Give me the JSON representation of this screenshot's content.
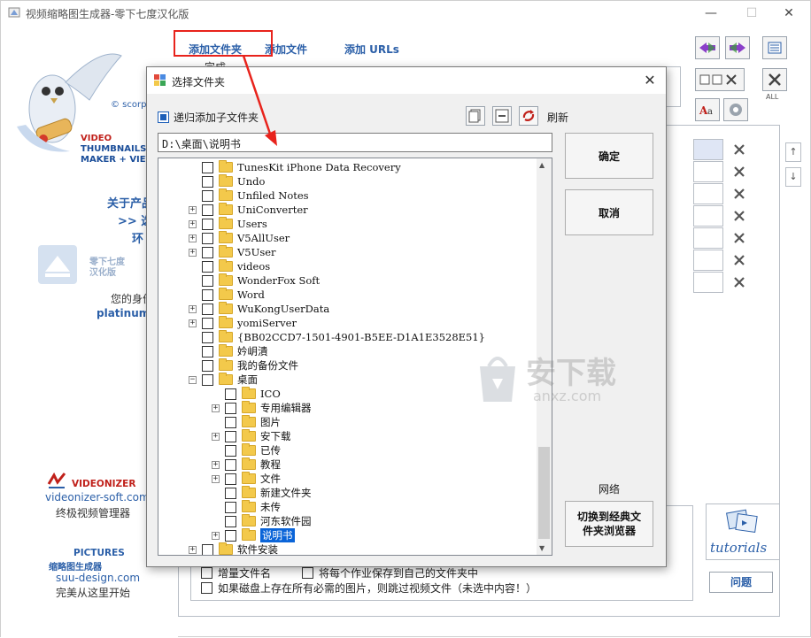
{
  "window": {
    "title": "视频缩略图生成器-零下七度汉化版",
    "minimize": "—",
    "maximize": "☐",
    "close": "✕"
  },
  "top_links": {
    "add_folder": "添加文件夹",
    "add_file": "添加文件",
    "add_urls": "添加 URLs",
    "done_label": "完成"
  },
  "left_panel": {
    "copyright": "© scorp",
    "logo_line1": "VIDEO",
    "logo_line2": "THUMBNAILS",
    "logo_line3": "MAKER + VIEV",
    "about1": "关于产品",
    "about2": ">> 选",
    "about3": "环",
    "hanhua1": "零下七度",
    "hanhua2": "汉化版",
    "identity": "您的身份",
    "edition": "platinum [",
    "videonizer_brand": "VIDEONIZER",
    "videonizer_url": "videonizer-soft.com",
    "videonizer_desc": "终极视频管理器",
    "pictures_brand": "PICTURES",
    "pictures_sub": "缩略图生成器",
    "pictures_url": "suu-design.com",
    "pictures_desc": "完美从这里开始"
  },
  "right_panel": {
    "all_label": "ALL",
    "tutorials_label": "tutorials",
    "problem_button": "问题"
  },
  "bottom_options": {
    "opt1": "增量文件名",
    "opt2": "将每个作业保存到自己的文件夹中",
    "opt3": "如果磁盘上存在所有必需的图片，则跳过视频文件（未选中内容！）"
  },
  "dialog": {
    "title": "选择文件夹",
    "recursive_label": "递归添加子文件夹",
    "refresh_label": "刷新",
    "path_value": "D:\\桌面\\说明书",
    "ok_button": "确定",
    "cancel_button": "取消",
    "network_label": "网络",
    "switch_button": "切换到经典文件夹浏览器",
    "tree": [
      {
        "label": "TunesKit iPhone Data Recovery",
        "expandable": false,
        "level": 0
      },
      {
        "label": "Undo",
        "expandable": false,
        "level": 0
      },
      {
        "label": "Unfiled Notes",
        "expandable": false,
        "level": 0
      },
      {
        "label": "UniConverter",
        "expandable": true,
        "level": 0
      },
      {
        "label": "Users",
        "expandable": true,
        "level": 0
      },
      {
        "label": "V5AllUser",
        "expandable": true,
        "level": 0
      },
      {
        "label": "V5User",
        "expandable": true,
        "level": 0
      },
      {
        "label": "videos",
        "expandable": false,
        "level": 0
      },
      {
        "label": "WonderFox Soft",
        "expandable": false,
        "level": 0
      },
      {
        "label": "Word",
        "expandable": false,
        "level": 0
      },
      {
        "label": "WuKongUserData",
        "expandable": true,
        "level": 0
      },
      {
        "label": "yomiServer",
        "expandable": true,
        "level": 0
      },
      {
        "label": "{BB02CCD7-1501-4901-B5EE-D1A1E3528E51}",
        "expandable": false,
        "level": 0
      },
      {
        "label": "妗岄潰",
        "expandable": false,
        "level": 0
      },
      {
        "label": "我的备份文件",
        "expandable": false,
        "level": 0
      },
      {
        "label": "桌面",
        "expandable": "open",
        "level": 0
      },
      {
        "label": "ICO",
        "expandable": false,
        "level": 1
      },
      {
        "label": "专用编辑器",
        "expandable": true,
        "level": 1
      },
      {
        "label": "图片",
        "expandable": false,
        "level": 1
      },
      {
        "label": "安下载",
        "expandable": true,
        "level": 1
      },
      {
        "label": "已传",
        "expandable": false,
        "level": 1
      },
      {
        "label": "教程",
        "expandable": true,
        "level": 1
      },
      {
        "label": "文件",
        "expandable": true,
        "level": 1
      },
      {
        "label": "新建文件夹",
        "expandable": false,
        "level": 1
      },
      {
        "label": "未传",
        "expandable": false,
        "level": 1
      },
      {
        "label": "河东软件园",
        "expandable": false,
        "level": 1
      },
      {
        "label": "说明书",
        "expandable": true,
        "level": 1,
        "selected": true
      },
      {
        "label": "软件安装",
        "expandable": true,
        "level": 0
      }
    ]
  },
  "watermark": {
    "text": "安下载",
    "url": "anxz.com"
  },
  "colors": {
    "accent": "#2b5fa8",
    "annotation": "#e8231c",
    "selection": "#0a64d8",
    "folder": "#f3c94b"
  }
}
